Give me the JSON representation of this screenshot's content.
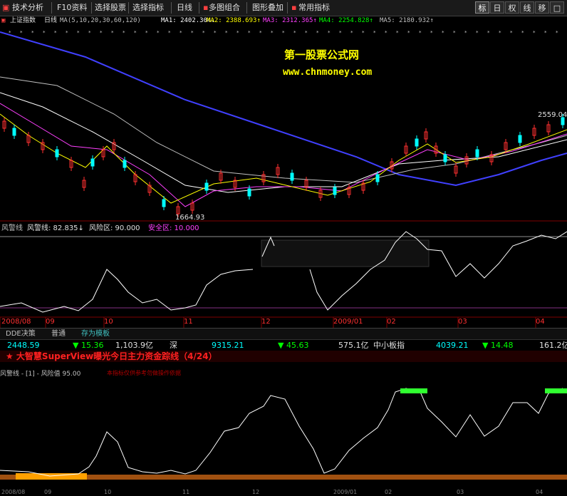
{
  "toolbar": {
    "menu_icon": "menu-icon",
    "items": [
      "技术分析",
      "F10资料",
      "选择股票",
      "选择指标",
      "日线",
      "多图组合",
      "图形叠加",
      "常用指标"
    ],
    "right_buttons": [
      "标",
      "日",
      "权",
      "线",
      "移",
      "□"
    ]
  },
  "main_chart": {
    "index_name": "上证指数",
    "period": "日线",
    "ma_spec": "MA(5,10,20,30,60,120)",
    "ma1": "MA1: 2402.304↓",
    "ma2": "MA2: 2388.693↑",
    "ma3": "MA3: 2312.365↑",
    "ma4": "MA4: 2254.828↑",
    "ma5": "MA5: 2180.932↑",
    "high_label": "2559.04",
    "low_label": "1664.93",
    "colors": {
      "ma1": "#ffffff",
      "ma2": "#ffff00",
      "ma3": "#ff00ff",
      "ma4": "#00ff00",
      "ma5": "#c0c0c0",
      "ma6": "#4040ff",
      "up": "#ff3030",
      "down": "#00ffff"
    }
  },
  "watermark": {
    "line1": "第一股票公式网",
    "line2": "www.chnmoney.com"
  },
  "indicator_panel": {
    "name": "风警线",
    "label": "风警线: 82.835↓",
    "risk_label": "风险区: 90.000",
    "safe_label": "安全区: 10.000"
  },
  "date_axis": {
    "labels": [
      "2008/08",
      "09",
      "10",
      "11",
      "12",
      "2009/01",
      "02",
      "03",
      "04"
    ]
  },
  "dde_bar": {
    "tabs": [
      "DDE决策",
      "普通",
      "存为模板"
    ]
  },
  "ticker": {
    "sh_value": "2448.59",
    "sh_change": "▼ 15.36",
    "sh_amount": "1,103.9亿",
    "sz_name": "深",
    "sz_value": "9315.21",
    "sz_change": "▼ 45.63",
    "sz_amount": "575.1亿",
    "sme_name": "中小板指",
    "sme_value": "4039.21",
    "sme_change": "▼ 14.48",
    "sme_amount": "161.2亿"
  },
  "scroll_banner": {
    "text": "★ 大智慧SuperView曝光今日主力资金踪线（4/24）"
  },
  "sub_panel": {
    "label": "风警线 - [1] - 风险值 95.00",
    "note": "本指标仅供参考勿做操作依据"
  },
  "bottom_axis": {
    "labels": [
      "2008/08",
      "09",
      "10",
      "11",
      "12",
      "2009/01",
      "02",
      "03",
      "04"
    ]
  }
}
